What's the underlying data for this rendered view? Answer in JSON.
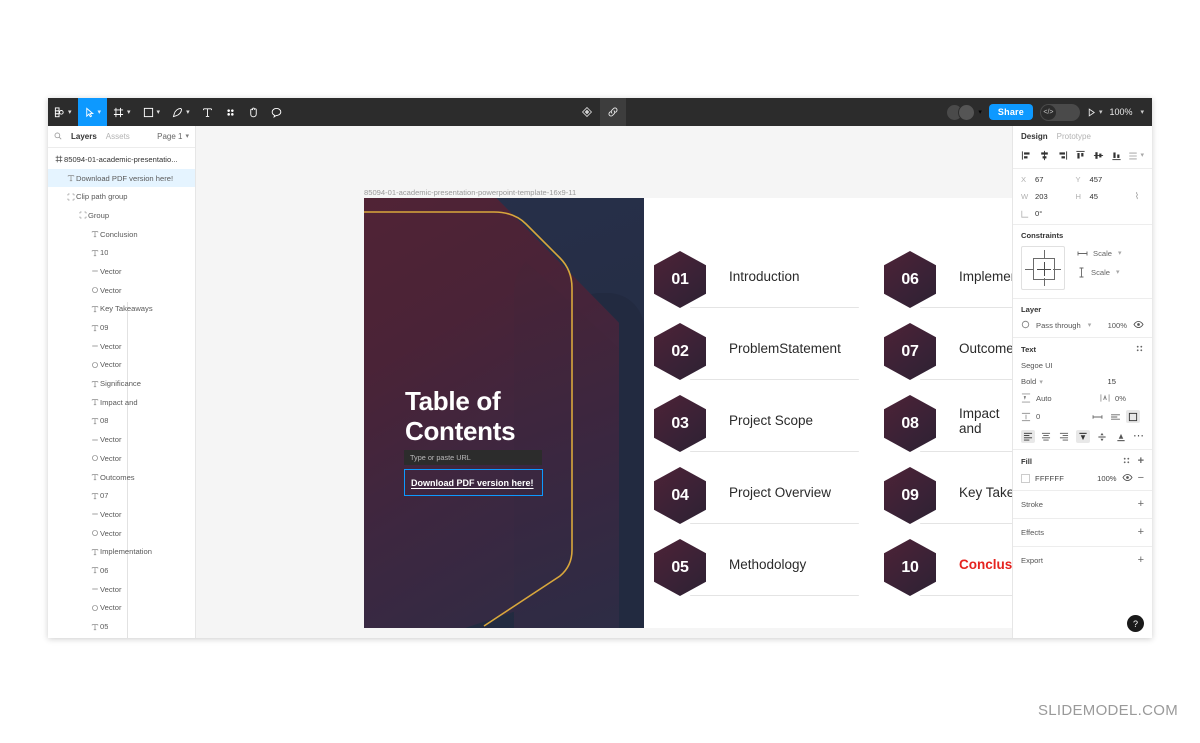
{
  "toolbar": {
    "menu_label": "figma-menu",
    "tools": [
      {
        "name": "move-tool",
        "label": "Move"
      },
      {
        "name": "frame-tool",
        "label": "Frame"
      },
      {
        "name": "shape-tool",
        "label": "Rectangle"
      },
      {
        "name": "pen-tool",
        "label": "Pen"
      },
      {
        "name": "text-tool",
        "label": "Text"
      },
      {
        "name": "components-tool",
        "label": "Components"
      },
      {
        "name": "hand-tool",
        "label": "Hand"
      },
      {
        "name": "comment-tool",
        "label": "Comment"
      }
    ],
    "center": [
      {
        "name": "move-anchor-icon",
        "label": "Actions"
      },
      {
        "name": "link-icon",
        "label": "Link"
      }
    ],
    "share_label": "Share",
    "devmode_glyph": "</>",
    "zoom_level": "100%",
    "present_label": "Present"
  },
  "left_panel": {
    "tabs": [
      {
        "label": "Layers",
        "active": true
      },
      {
        "label": "Assets",
        "active": false
      }
    ],
    "page_label": "Page 1",
    "layers": [
      {
        "label": "85094-01-academic-presentatio...",
        "icon": "frame",
        "depth": 0,
        "selected": false,
        "bold": true
      },
      {
        "label": "Download PDF version here!",
        "icon": "text",
        "depth": 1,
        "selected": true,
        "bold": false
      },
      {
        "label": "Clip path group",
        "icon": "group",
        "depth": 1,
        "selected": false,
        "bold": false
      },
      {
        "label": "Group",
        "icon": "group",
        "depth": 2,
        "selected": false,
        "bold": false
      },
      {
        "label": "Conclusion",
        "icon": "text",
        "depth": 3,
        "selected": false,
        "bold": false
      },
      {
        "label": "10",
        "icon": "text",
        "depth": 3,
        "selected": false,
        "bold": false
      },
      {
        "label": "Vector",
        "icon": "line",
        "depth": 3,
        "selected": false,
        "bold": false
      },
      {
        "label": "Vector",
        "icon": "ellipse",
        "depth": 3,
        "selected": false,
        "bold": false
      },
      {
        "label": "Key Takeaways",
        "icon": "text",
        "depth": 3,
        "selected": false,
        "bold": false
      },
      {
        "label": "09",
        "icon": "text",
        "depth": 3,
        "selected": false,
        "bold": false
      },
      {
        "label": "Vector",
        "icon": "line",
        "depth": 3,
        "selected": false,
        "bold": false
      },
      {
        "label": "Vector",
        "icon": "ellipse",
        "depth": 3,
        "selected": false,
        "bold": false
      },
      {
        "label": "Significance",
        "icon": "text",
        "depth": 3,
        "selected": false,
        "bold": false
      },
      {
        "label": "Impact and",
        "icon": "text",
        "depth": 3,
        "selected": false,
        "bold": false
      },
      {
        "label": "08",
        "icon": "text",
        "depth": 3,
        "selected": false,
        "bold": false
      },
      {
        "label": "Vector",
        "icon": "line",
        "depth": 3,
        "selected": false,
        "bold": false
      },
      {
        "label": "Vector",
        "icon": "ellipse",
        "depth": 3,
        "selected": false,
        "bold": false
      },
      {
        "label": "Outcomes",
        "icon": "text",
        "depth": 3,
        "selected": false,
        "bold": false
      },
      {
        "label": "07",
        "icon": "text",
        "depth": 3,
        "selected": false,
        "bold": false
      },
      {
        "label": "Vector",
        "icon": "line",
        "depth": 3,
        "selected": false,
        "bold": false
      },
      {
        "label": "Vector",
        "icon": "ellipse",
        "depth": 3,
        "selected": false,
        "bold": false
      },
      {
        "label": "Implementation",
        "icon": "text",
        "depth": 3,
        "selected": false,
        "bold": false
      },
      {
        "label": "06",
        "icon": "text",
        "depth": 3,
        "selected": false,
        "bold": false
      },
      {
        "label": "Vector",
        "icon": "line",
        "depth": 3,
        "selected": false,
        "bold": false
      },
      {
        "label": "Vector",
        "icon": "ellipse",
        "depth": 3,
        "selected": false,
        "bold": false
      },
      {
        "label": "05",
        "icon": "text",
        "depth": 3,
        "selected": false,
        "bold": false
      }
    ]
  },
  "canvas": {
    "frame_name": "85094-01-academic-presentation-powerpoint-template-16x9-11",
    "slide": {
      "title_line1": "Table of",
      "title_line2": "Contents",
      "url_tooltip_placeholder": "Type or paste URL",
      "link_text": "Download PDF version here!",
      "toc_left": [
        {
          "num": "01",
          "label": "Introduction",
          "highlight": false
        },
        {
          "num": "02",
          "label": "Problem\nStatement",
          "highlight": false
        },
        {
          "num": "03",
          "label": "Project Scope",
          "highlight": false
        },
        {
          "num": "04",
          "label": "Project Overview",
          "highlight": false
        },
        {
          "num": "05",
          "label": "Methodology",
          "highlight": false
        }
      ],
      "toc_right": [
        {
          "num": "06",
          "label": "Implementation",
          "highlight": false
        },
        {
          "num": "07",
          "label": "Outcomes",
          "highlight": false
        },
        {
          "num": "08",
          "label": "Impact and\nSignificance",
          "highlight": false
        },
        {
          "num": "09",
          "label": "Key Takeaways",
          "highlight": false
        },
        {
          "num": "10",
          "label": "Conclusion",
          "highlight": true
        }
      ]
    }
  },
  "right_panel": {
    "tabs": [
      {
        "label": "Design",
        "active": true
      },
      {
        "label": "Prototype",
        "active": false
      }
    ],
    "position": {
      "x_key": "X",
      "x_value": "67",
      "y_key": "Y",
      "y_value": "457",
      "w_key": "W",
      "w_value": "203",
      "h_key": "H",
      "h_value": "45",
      "rotation_value": "0°"
    },
    "constraints": {
      "title": "Constraints",
      "horizontal": "Scale",
      "vertical": "Scale"
    },
    "layer": {
      "title": "Layer",
      "blend_mode": "Pass through",
      "opacity": "100%"
    },
    "text": {
      "title": "Text",
      "font_family": "Segoe UI",
      "font_weight": "Bold",
      "font_size": "15",
      "line_height": "Auto",
      "letter_spacing": "0%",
      "paragraph_spacing": "0"
    },
    "fill": {
      "title": "Fill",
      "color_hex": "FFFFFF",
      "opacity": "100%"
    },
    "stroke_title": "Stroke",
    "effects_title": "Effects",
    "export_title": "Export",
    "help_glyph": "?"
  },
  "watermark": "SLIDEMODEL.COM",
  "colors": {
    "accent_blue": "#0d99ff",
    "toolbar_bg": "#2c2c2c",
    "slide_maroon": "#4a2336",
    "slide_navy": "#222a40",
    "gold_line": "#d9a73c",
    "conclusion_red": "#e5231f"
  }
}
